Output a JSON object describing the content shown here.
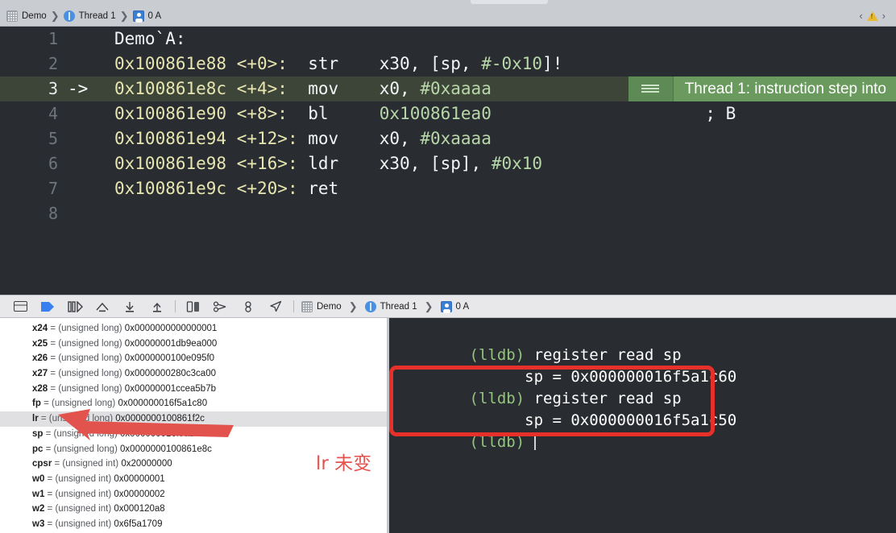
{
  "jumpbar": {
    "crumbs": [
      {
        "icon": "project-icon",
        "label": "Demo"
      },
      {
        "icon": "thread-icon",
        "label": "Thread 1"
      },
      {
        "icon": "stack-frame-icon",
        "label": "0 A"
      }
    ],
    "separator": "❯",
    "back_label": "‹",
    "forward_label": "›",
    "warning_icon": "warning-triangle-icon"
  },
  "editor": {
    "lines": [
      {
        "num": "1",
        "arrow": "",
        "current": false,
        "label": "Demo`A:",
        "addr": "",
        "offset": "",
        "mnemonic": "",
        "operands": "",
        "imm": "",
        "comment": ""
      },
      {
        "num": "2",
        "arrow": "",
        "current": false,
        "label": "",
        "addr": "0x100861e88",
        "offset": "<+0>:",
        "mnemonic": "str",
        "operands": "x30, [sp, ",
        "imm": "#-0x10",
        "tail": "]!",
        "comment": ""
      },
      {
        "num": "3",
        "arrow": "->",
        "current": true,
        "label": "",
        "addr": "0x100861e8c",
        "offset": "<+4>:",
        "mnemonic": "mov",
        "operands": "x0, ",
        "imm": "#0xaaaa",
        "tail": "",
        "comment": ""
      },
      {
        "num": "4",
        "arrow": "",
        "current": false,
        "label": "",
        "addr": "0x100861e90",
        "offset": "<+8>:",
        "mnemonic": "bl",
        "operands": "",
        "imm": "0x100861ea0",
        "tail": "",
        "comment": "; B"
      },
      {
        "num": "5",
        "arrow": "",
        "current": false,
        "label": "",
        "addr": "0x100861e94",
        "offset": "<+12>:",
        "mnemonic": "mov",
        "operands": "x0, ",
        "imm": "#0xaaaa",
        "tail": "",
        "comment": ""
      },
      {
        "num": "6",
        "arrow": "",
        "current": false,
        "label": "",
        "addr": "0x100861e98",
        "offset": "<+16>:",
        "mnemonic": "ldr",
        "operands": "x30, [sp], ",
        "imm": "#0x10",
        "tail": "",
        "comment": ""
      },
      {
        "num": "7",
        "arrow": "",
        "current": false,
        "label": "",
        "addr": "0x100861e9c",
        "offset": "<+20>:",
        "mnemonic": "ret",
        "operands": "",
        "imm": "",
        "tail": "",
        "comment": ""
      },
      {
        "num": "8",
        "arrow": "",
        "current": false,
        "label": "",
        "addr": "",
        "offset": "",
        "mnemonic": "",
        "operands": "",
        "imm": "",
        "tail": "",
        "comment": ""
      }
    ],
    "annotation": {
      "handle_icon": "list-lines-icon",
      "text": "Thread 1: instruction step into"
    },
    "colors": {
      "background": "#292c31",
      "current_line": "#3d4539",
      "address": "#e8e6b0",
      "immediate": "#b7d7a8",
      "annotation_bg": "#6a9a5e"
    }
  },
  "debugbar": {
    "buttons": [
      {
        "name": "hide-debug-area-button",
        "icon": "panel-toggle-icon"
      },
      {
        "name": "continue-button",
        "icon": "continue-icon"
      },
      {
        "name": "step-over-button",
        "icon": "step-over-icon"
      },
      {
        "name": "step-into-button",
        "icon": "step-into-icon"
      },
      {
        "name": "step-out-button",
        "icon": "step-out-icon"
      },
      {
        "name": "step-out-alt-button",
        "icon": "step-out-alt-icon"
      },
      {
        "name": "debug-view-hierarchy-button",
        "icon": "view-hierarchy-icon"
      },
      {
        "name": "debug-memory-graph-button",
        "icon": "memory-graph-icon"
      },
      {
        "name": "environment-overrides-button",
        "icon": "environment-icon"
      },
      {
        "name": "simulate-location-button",
        "icon": "location-arrow-icon"
      }
    ],
    "crumbs": [
      {
        "icon": "project-icon",
        "label": "Demo"
      },
      {
        "icon": "thread-icon",
        "label": "Thread 1"
      },
      {
        "icon": "stack-frame-icon",
        "label": "0 A"
      }
    ],
    "separator": "❯"
  },
  "variables": {
    "rows": [
      {
        "name": "x24",
        "type": "(unsigned long)",
        "value": "0x0000000000000001",
        "selected": false
      },
      {
        "name": "x25",
        "type": "(unsigned long)",
        "value": "0x00000001db9ea000",
        "selected": false
      },
      {
        "name": "x26",
        "type": "(unsigned long)",
        "value": "0x0000000100e095f0",
        "selected": false
      },
      {
        "name": "x27",
        "type": "(unsigned long)",
        "value": "0x0000000280c3ca00",
        "selected": false
      },
      {
        "name": "x28",
        "type": "(unsigned long)",
        "value": "0x00000001ccea5b7b",
        "selected": false
      },
      {
        "name": "fp",
        "type": "(unsigned long)",
        "value": "0x000000016f5a1c80",
        "selected": false
      },
      {
        "name": "lr",
        "type": "(unsigned long)",
        "value": "0x0000000100861f2c",
        "selected": true
      },
      {
        "name": "sp",
        "type": "(unsigned long)",
        "value": "0x000000016f5a1c50",
        "selected": false
      },
      {
        "name": "pc",
        "type": "(unsigned long)",
        "value": "0x0000000100861e8c",
        "selected": false
      },
      {
        "name": "cpsr",
        "type": "(unsigned int)",
        "value": "0x20000000",
        "selected": false
      },
      {
        "name": "w0",
        "type": "(unsigned int)",
        "value": "0x00000001",
        "selected": false
      },
      {
        "name": "w1",
        "type": "(unsigned int)",
        "value": "0x00000002",
        "selected": false
      },
      {
        "name": "w2",
        "type": "(unsigned int)",
        "value": "0x000120a8",
        "selected": false
      },
      {
        "name": "w3",
        "type": "(unsigned int)",
        "value": "0x6f5a1709",
        "selected": false
      }
    ],
    "equals": "="
  },
  "console": {
    "lines": [
      {
        "prompt": "(lldb)",
        "cmd": " register read sp",
        "out": ""
      },
      {
        "prompt": "",
        "cmd": "",
        "out": "      sp = 0x000000016f5a1c60"
      },
      {
        "prompt": "(lldb)",
        "cmd": " register read sp",
        "out": ""
      },
      {
        "prompt": "",
        "cmd": "",
        "out": "      sp = 0x000000016f5a1c50"
      },
      {
        "prompt": "(lldb)",
        "cmd": " ",
        "out": "",
        "caret": true
      }
    ],
    "highlight_color": "#e8302b"
  },
  "annotation_overlay": {
    "note_text": "lr 未变",
    "note_color": "#e2534e",
    "arrow_color": "#e2534e",
    "arrow_name": "red-pointer-arrow"
  }
}
